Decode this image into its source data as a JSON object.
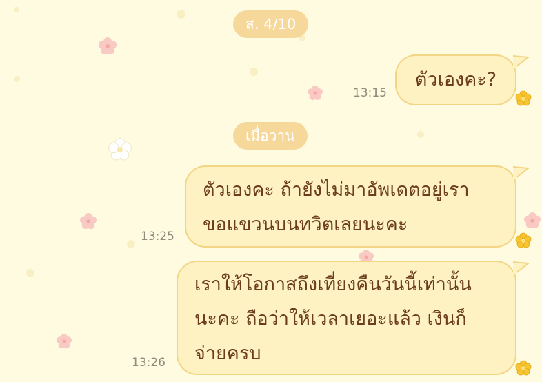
{
  "chat": {
    "date_separators": [
      {
        "label": "ส. 4/10"
      },
      {
        "label": "เมื่อวาน"
      }
    ],
    "messages": [
      {
        "lines": [
          "ตัวเองคะ?"
        ],
        "time": "13:15",
        "direction": "outgoing"
      },
      {
        "lines": [
          "ตัวเองคะ ถ้ายังไม่มาอัพเดตอยู่เรา",
          "ขอแขวนบนทวิตเลยนะคะ"
        ],
        "time": "13:25",
        "direction": "outgoing"
      },
      {
        "lines": [
          "เราให้โอกาสถึงเที่ยงคืนวันนี้เท่านั้น",
          "นะคะ ถือว่าให้เวลาเยอะแล้ว เงินก็",
          "จ่ายครบ"
        ],
        "time": "13:26",
        "direction": "outgoing"
      }
    ],
    "colors": {
      "background": "#FEFBE0",
      "bubble_fill": "#FEF2C2",
      "bubble_border": "#F2D585",
      "text": "#6B3D1D",
      "date_chip": "#F6D89A",
      "time_text": "#8E8A7C",
      "flower_pink": "#F9C4C0",
      "flower_yellow": "#F7C531"
    },
    "icons": {
      "bubble_decoration": "flower-icon",
      "background_decoration": "flower-icon"
    }
  }
}
